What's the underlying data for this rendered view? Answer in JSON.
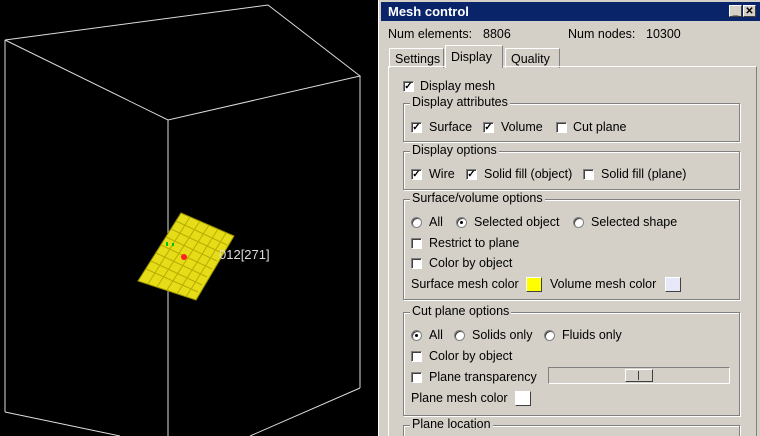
{
  "viewport": {
    "mesh_label": "012[271]"
  },
  "window": {
    "title": "Mesh control",
    "minimize": "_",
    "close": "✕"
  },
  "summary": {
    "elements_label": "Num elements:",
    "elements_value": "8806",
    "nodes_label": "Num nodes:",
    "nodes_value": "10300"
  },
  "tabs": [
    {
      "label": "Settings",
      "active": false
    },
    {
      "label": "Display",
      "active": true
    },
    {
      "label": "Quality",
      "active": false
    }
  ],
  "display_mesh": {
    "label": "Display mesh",
    "checked": true
  },
  "display_attributes": {
    "title": "Display attributes",
    "surface": {
      "label": "Surface",
      "checked": true
    },
    "volume": {
      "label": "Volume",
      "checked": true
    },
    "cut_plane": {
      "label": "Cut plane",
      "checked": false
    }
  },
  "display_options": {
    "title": "Display options",
    "wire": {
      "label": "Wire",
      "checked": true
    },
    "solid_fill_object": {
      "label": "Solid fill (object)",
      "checked": true
    },
    "solid_fill_plane": {
      "label": "Solid fill (plane)",
      "checked": false
    }
  },
  "surface_volume_options": {
    "title": "Surface/volume options",
    "all": {
      "label": "All",
      "selected": false
    },
    "selected_object": {
      "label": "Selected object",
      "selected": true
    },
    "selected_shape": {
      "label": "Selected shape",
      "selected": false
    },
    "restrict_to_plane": {
      "label": "Restrict to plane",
      "checked": false
    },
    "color_by_object": {
      "label": "Color by object",
      "checked": false
    },
    "surface_mesh_color_label": "Surface mesh color",
    "surface_mesh_color": "#ffff00",
    "volume_mesh_color_label": "Volume mesh color",
    "volume_mesh_color": "#e8e8f8"
  },
  "cut_plane_options": {
    "title": "Cut plane options",
    "all": {
      "label": "All",
      "selected": true
    },
    "solids_only": {
      "label": "Solids only",
      "selected": false
    },
    "fluids_only": {
      "label": "Fluids only",
      "selected": false
    },
    "color_by_object": {
      "label": "Color by object",
      "checked": false
    },
    "plane_transparency": {
      "label": "Plane transparency",
      "checked": false
    },
    "plane_mesh_color_label": "Plane mesh color",
    "plane_mesh_color": "#ffffff"
  },
  "plane_location": {
    "title": "Plane location"
  }
}
